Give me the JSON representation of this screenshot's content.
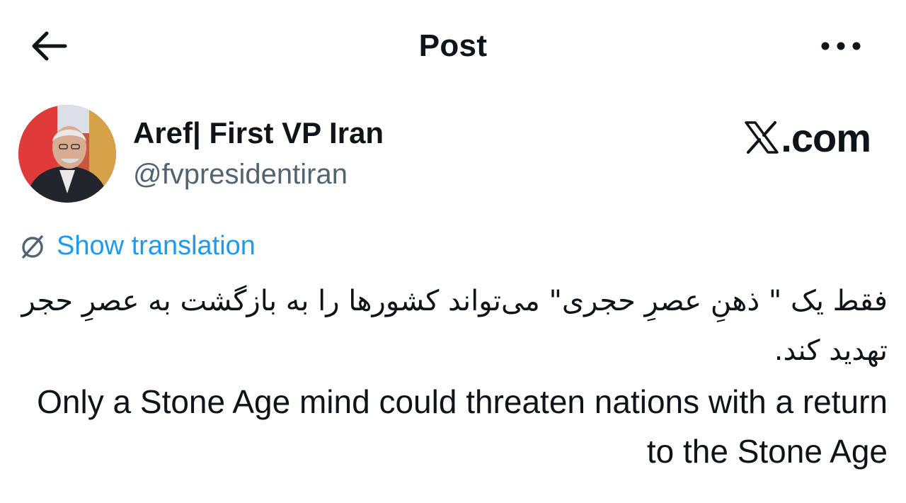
{
  "header": {
    "title": "Post",
    "back_icon": "arrow-left-icon",
    "more_icon": "more-horizontal-icon"
  },
  "author": {
    "display_name": "Aref| First VP Iran",
    "handle": "@fvpresidentiran"
  },
  "watermark": {
    "logo_icon": "x-logo-icon",
    "text": ".com"
  },
  "translation": {
    "icon": "globe-slash-icon",
    "label": "Show translation"
  },
  "tweet": {
    "persian_text": "فقط یک \" ذهنِ عصرِ حجری\" می‌تواند کشورها را به بازگشت به عصرِ حجر تهدید کند.",
    "english_text": "Only a Stone Age mind could threaten nations with a return to the Stone Age"
  },
  "colors": {
    "text": "#0f1419",
    "secondary": "#536471",
    "link": "#1d9bf0",
    "background": "#ffffff"
  }
}
